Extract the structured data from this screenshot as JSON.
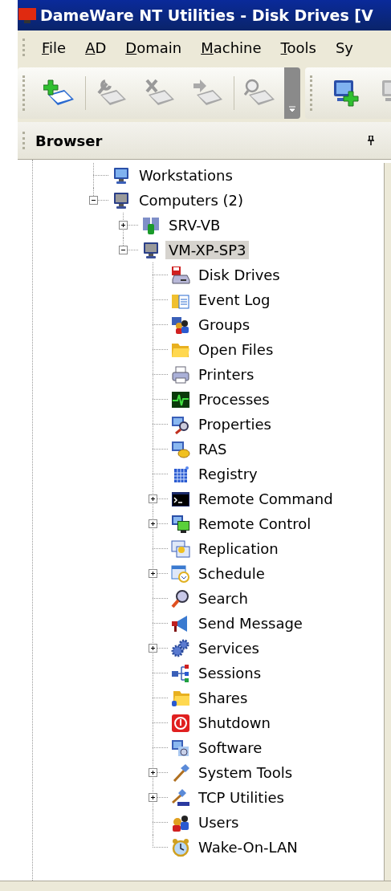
{
  "window": {
    "title": "DameWare NT Utilities - Disk Drives [V"
  },
  "menu": [
    {
      "label": "File",
      "mnemonic": true
    },
    {
      "label": "AD",
      "mnemonic": true
    },
    {
      "label": "Domain",
      "mnemonic": true
    },
    {
      "label": "Machine",
      "mnemonic": true
    },
    {
      "label": "Tools",
      "mnemonic": true
    },
    {
      "label": "Sy",
      "mnemonic": false
    }
  ],
  "toolbar": [
    {
      "disabled": false
    },
    {
      "disabled": true
    },
    {
      "disabled": true
    },
    {
      "disabled": true
    },
    {
      "disabled": true
    }
  ],
  "toolbar_2": [
    {
      "disabled": false
    },
    {
      "disabled": true
    }
  ],
  "panel": {
    "title": "Browser"
  },
  "tree": [
    {
      "label": "Workstations",
      "expandable": false,
      "selected": false
    },
    {
      "label": "Computers (2)",
      "expandable": true,
      "expanded": true,
      "selected": false,
      "children": [
        {
          "label": "SRV-VB",
          "expandable": true,
          "expanded": false,
          "selected": false
        },
        {
          "label": "VM-XP-SP3",
          "expandable": true,
          "expanded": true,
          "selected": true,
          "children": [
            {
              "label": "Disk Drives",
              "expandable": false,
              "selected": false
            },
            {
              "label": "Event Log",
              "expandable": false,
              "selected": false
            },
            {
              "label": "Groups",
              "expandable": false,
              "selected": false
            },
            {
              "label": "Open Files",
              "expandable": false,
              "selected": false
            },
            {
              "label": "Printers",
              "expandable": false,
              "selected": false
            },
            {
              "label": "Processes",
              "expandable": false,
              "selected": false
            },
            {
              "label": "Properties",
              "expandable": false,
              "selected": false
            },
            {
              "label": "RAS",
              "expandable": false,
              "selected": false
            },
            {
              "label": "Registry",
              "expandable": false,
              "selected": false
            },
            {
              "label": "Remote Command",
              "expandable": true,
              "expanded": false,
              "selected": false
            },
            {
              "label": "Remote Control",
              "expandable": true,
              "expanded": false,
              "selected": false
            },
            {
              "label": "Replication",
              "expandable": false,
              "selected": false
            },
            {
              "label": "Schedule",
              "expandable": true,
              "expanded": false,
              "selected": false
            },
            {
              "label": "Search",
              "expandable": false,
              "selected": false
            },
            {
              "label": "Send Message",
              "expandable": false,
              "selected": false
            },
            {
              "label": "Services",
              "expandable": true,
              "expanded": false,
              "selected": false
            },
            {
              "label": "Sessions",
              "expandable": false,
              "selected": false
            },
            {
              "label": "Shares",
              "expandable": false,
              "selected": false
            },
            {
              "label": "Shutdown",
              "expandable": false,
              "selected": false
            },
            {
              "label": "Software",
              "expandable": false,
              "selected": false
            },
            {
              "label": "System Tools",
              "expandable": true,
              "expanded": false,
              "selected": false
            },
            {
              "label": "TCP Utilities",
              "expandable": true,
              "expanded": false,
              "selected": false
            },
            {
              "label": "Users",
              "expandable": false,
              "selected": false
            },
            {
              "label": "Wake-On-LAN",
              "expandable": false,
              "selected": false
            }
          ]
        }
      ]
    }
  ]
}
